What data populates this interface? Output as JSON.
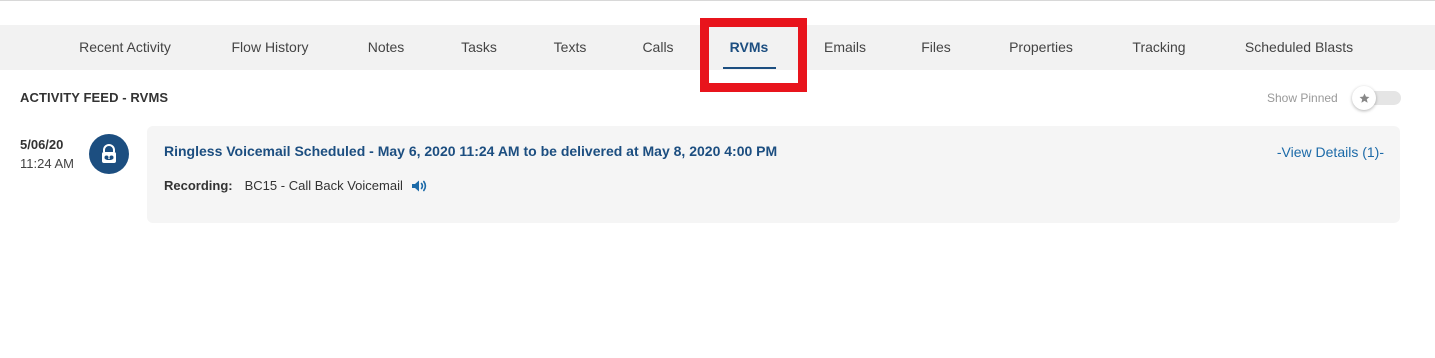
{
  "tabs": [
    {
      "label": "Recent Activity"
    },
    {
      "label": "Flow History"
    },
    {
      "label": "Notes"
    },
    {
      "label": "Tasks"
    },
    {
      "label": "Texts"
    },
    {
      "label": "Calls"
    },
    {
      "label": "RVMs",
      "active": true
    },
    {
      "label": "Emails"
    },
    {
      "label": "Files"
    },
    {
      "label": "Properties"
    },
    {
      "label": "Tracking"
    },
    {
      "label": "Scheduled Blasts"
    }
  ],
  "feed": {
    "title": "ACTIVITY FEED - RVMS",
    "show_pinned_label": "Show Pinned",
    "show_pinned_on": false
  },
  "entry": {
    "date": "5/06/20",
    "time": "11:24 AM",
    "type_icon": "voicemail-icon",
    "title": "Ringless Voicemail Scheduled - May 6, 2020 11:24 AM to be delivered at May 8, 2020 4:00 PM",
    "view_details": "-View Details (1)-",
    "recording_label": "Recording:",
    "recording_value": "BC15 - Call Back Voicemail",
    "play_icon": "speaker-icon"
  },
  "colors": {
    "brand": "#1c4e80",
    "link": "#1c6aa8",
    "highlight": "#e8141c",
    "tab_bar_bg": "#f2f2f2",
    "card_bg": "#f5f5f5"
  }
}
